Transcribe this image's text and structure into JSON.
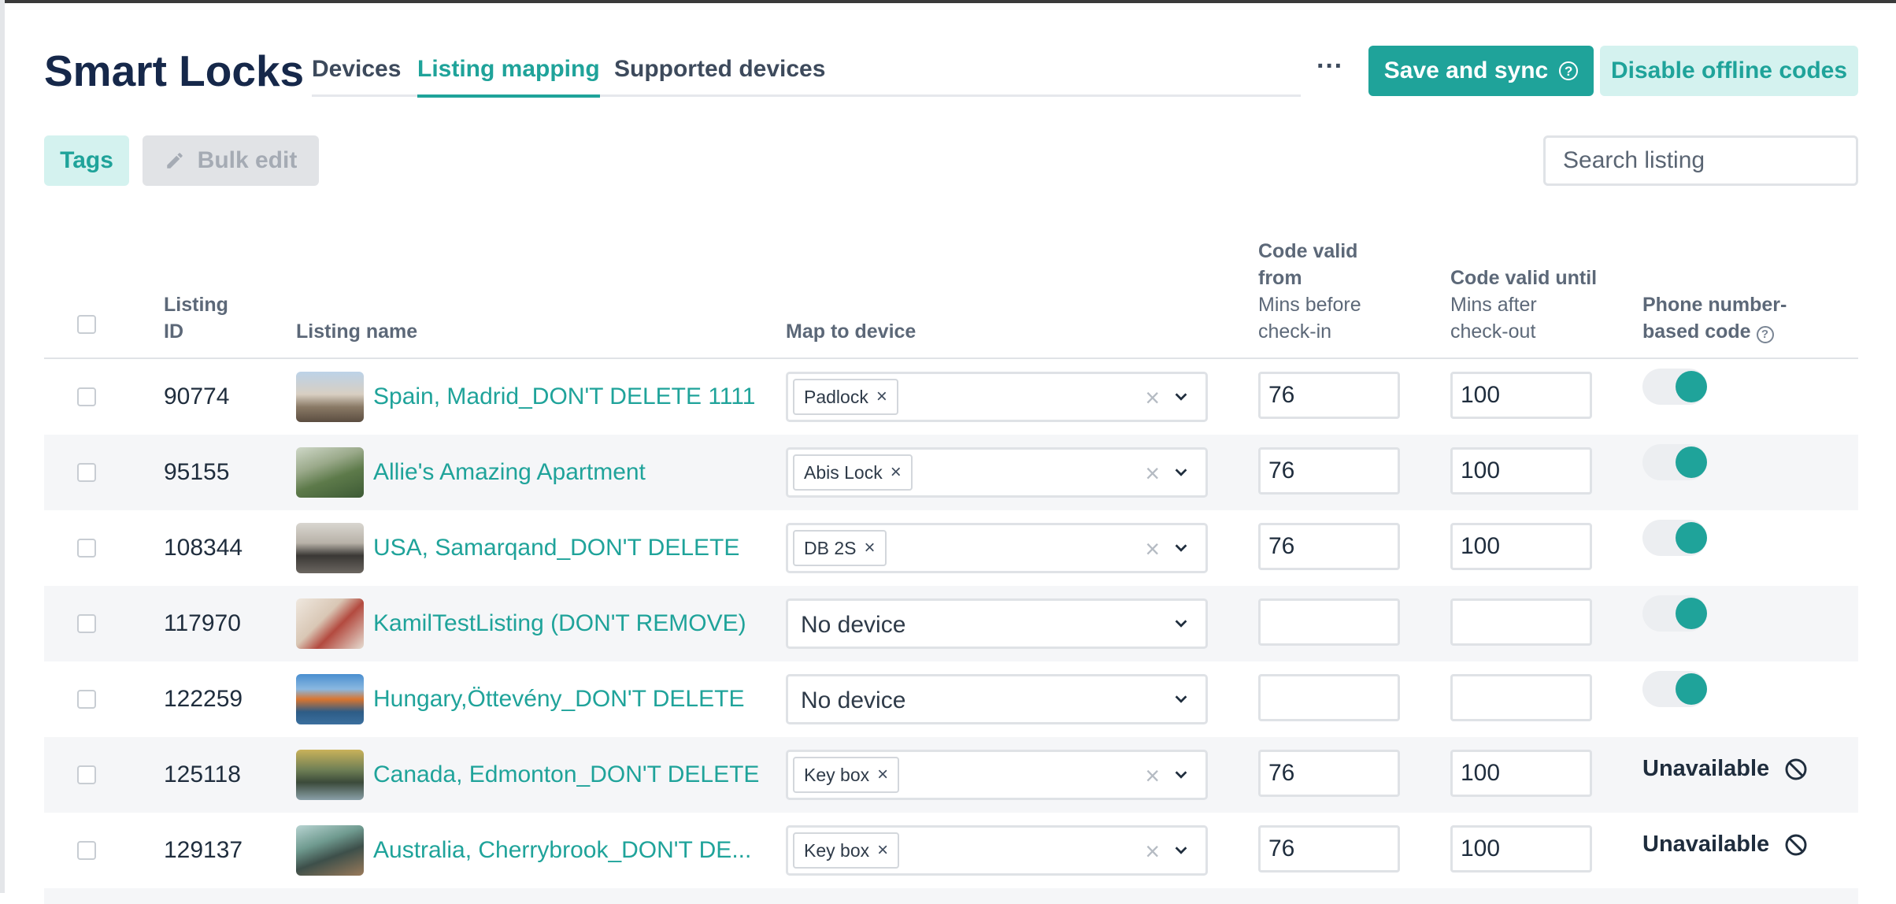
{
  "header": {
    "title": "Smart Locks",
    "tabs": [
      {
        "label": "Devices",
        "active": false
      },
      {
        "label": "Listing mapping",
        "active": true
      },
      {
        "label": "Supported devices",
        "active": false
      }
    ],
    "more_label": "···",
    "save_label": "Save and sync",
    "disable_label": "Disable offline codes"
  },
  "toolbar": {
    "tags_label": "Tags",
    "bulk_edit_label": "Bulk edit",
    "search_placeholder": "Search listing"
  },
  "table": {
    "columns": {
      "listing_id": "Listing ID",
      "listing_name": "Listing name",
      "map_to_device": "Map to device",
      "code_valid_from": "Code valid from",
      "code_valid_from_sub": "Mins before check-in",
      "code_valid_until": "Code valid until",
      "code_valid_until_sub": "Mins after check-out",
      "phone_code": "Phone number-based code"
    },
    "rows": [
      {
        "id": "90774",
        "name": "Spain, Madrid_DON'T DELETE 1111",
        "device": "Padlock",
        "from": "76",
        "until": "100",
        "phone": "on"
      },
      {
        "id": "95155",
        "name": "Allie's Amazing Apartment",
        "device": "Abis Lock",
        "from": "76",
        "until": "100",
        "phone": "on"
      },
      {
        "id": "108344",
        "name": "USA, Samarqand_DON'T DELETE",
        "device": "DB 2S",
        "from": "76",
        "until": "100",
        "phone": "on"
      },
      {
        "id": "117970",
        "name": "KamilTestListing (DON'T REMOVE)",
        "device": "No device",
        "from": "",
        "until": "",
        "phone": "on"
      },
      {
        "id": "122259",
        "name": "Hungary,Öttevény_DON'T DELETE",
        "device": "No device",
        "from": "",
        "until": "",
        "phone": "on"
      },
      {
        "id": "125118",
        "name": "Canada, Edmonton_DON'T DELETE",
        "device": "Key box",
        "from": "76",
        "until": "100",
        "phone": "Unavailable"
      },
      {
        "id": "129137",
        "name": "Australia, Cherrybrook_DON'T DE...",
        "device": "Key box",
        "from": "76",
        "until": "100",
        "phone": "Unavailable"
      }
    ]
  },
  "colors": {
    "accent": "#1fa39a",
    "accent_light": "#d4f2ef",
    "title": "#16284a"
  }
}
